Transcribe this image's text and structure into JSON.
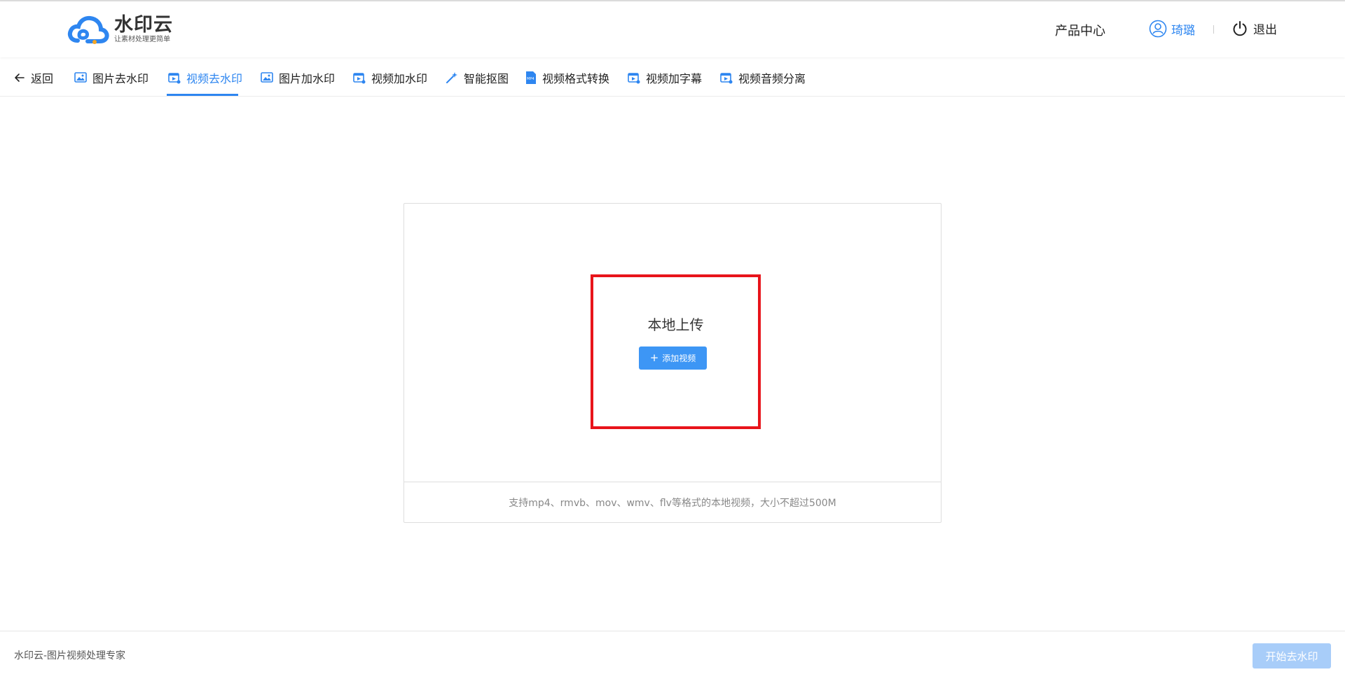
{
  "header": {
    "logo_name": "水印云",
    "logo_slogan": "让素材处理更简单",
    "product_center": "产品中心",
    "username": "琦璐",
    "logout": "退出"
  },
  "nav": {
    "back": "返回",
    "items": [
      {
        "label": "图片去水印",
        "icon": "image-icon"
      },
      {
        "label": "视频去水印",
        "icon": "video-icon",
        "active": true
      },
      {
        "label": "图片加水印",
        "icon": "image-icon"
      },
      {
        "label": "视频加水印",
        "icon": "video-icon"
      },
      {
        "label": "智能抠图",
        "icon": "magic-wand-icon"
      },
      {
        "label": "视频格式转换",
        "icon": "mp4-file-icon"
      },
      {
        "label": "视频加字幕",
        "icon": "video-icon"
      },
      {
        "label": "视频音频分离",
        "icon": "video-icon"
      }
    ]
  },
  "upload": {
    "title": "本地上传",
    "button_label": "添加视频",
    "hint": "支持mp4、rmvb、mov、wmv、flv等格式的本地视频，大小不超过500M"
  },
  "footer": {
    "text": "水印云-图片视频处理专家",
    "start_button": "开始去水印"
  },
  "colors": {
    "accent": "#2e86f0",
    "highlight_border": "#e8141b",
    "start_button_disabled": "#a8cdf9"
  }
}
